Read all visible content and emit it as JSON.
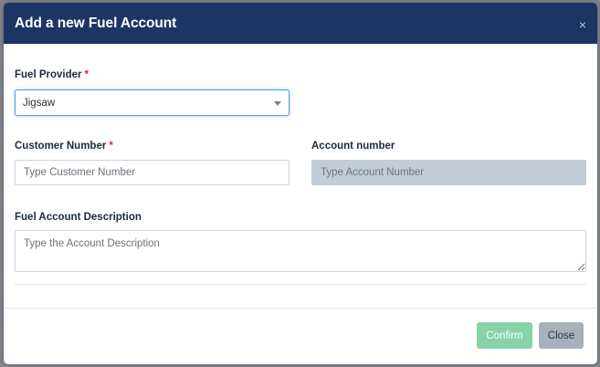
{
  "modal": {
    "title": "Add a new Fuel Account",
    "close_icon": "×"
  },
  "form": {
    "fuel_provider": {
      "label": "Fuel Provider",
      "required_mark": "*",
      "selected_value": "Jigsaw"
    },
    "customer_number": {
      "label": "Customer Number",
      "required_mark": "*",
      "placeholder": "Type Customer Number"
    },
    "account_number": {
      "label": "Account number",
      "placeholder": "Type Account Number",
      "disabled": true
    },
    "description": {
      "label": "Fuel Account Description",
      "placeholder": "Type the Account Description"
    }
  },
  "footer": {
    "confirm_label": "Confirm",
    "close_label": "Close"
  },
  "colors": {
    "header_bg": "#1c3564",
    "required": "#e0292b",
    "confirm_bg": "#86d3a8",
    "close_bg": "#a6b1bc",
    "disabled_input_bg": "#c2ccd6",
    "focus_border": "#5b9bd9"
  },
  "icons": {
    "close": "close-icon",
    "dropdown": "chevron-down-icon"
  }
}
